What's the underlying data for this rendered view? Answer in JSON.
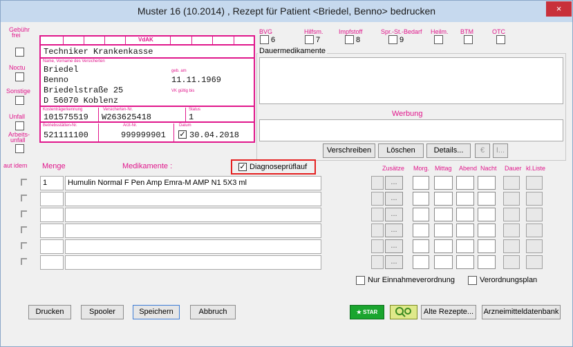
{
  "window": {
    "title": "Muster 16 (10.2014) , Rezept für Patient <Briedel, Benno> bedrucken",
    "close": "×"
  },
  "side_labels": {
    "gebuehr": "Gebühr",
    "frei": "frei",
    "noctu": "Noctu",
    "sonstige": "Sonstige",
    "unfall": "Unfall",
    "arbeits": "Arbeits-",
    "unfall2": "unfall"
  },
  "form": {
    "vdak": "VdAK",
    "kasse": "Techniker Krankenkasse",
    "name_label": "Name, Vorname des Versicherten",
    "lastname": "Briedel",
    "firstname": "Benno",
    "geb_label": "geb. am",
    "birthdate": "11.11.1969",
    "street": "Briedelstraße 25",
    "vk_label": "VK gültig bis",
    "city": "D 56070 Koblenz",
    "kt_label": "Kostenträgerkennung",
    "kt": "101575519",
    "vn_label": "Versicherten-Nr.",
    "vn": "W263625418",
    "status_label": "Status",
    "status": "1",
    "bs_label": "Betriebsstätten-Nr.",
    "bs": "521111100",
    "arzt_label": "Arzt-Nr.",
    "arzt": "999999901",
    "datum_label": "Datum",
    "datum": "30.04.2018"
  },
  "top_checks": [
    {
      "label": "BVG",
      "num": "6"
    },
    {
      "label": "Hilfsm.",
      "num": "7"
    },
    {
      "label": "Impfstoff",
      "num": "8"
    },
    {
      "label": "Spr.-St.-Bedarf",
      "num": "9"
    },
    {
      "label": "Heilm.",
      "num": ""
    },
    {
      "label": "BTM",
      "num": ""
    },
    {
      "label": "OTC",
      "num": ""
    }
  ],
  "dauer_label": "Dauermedikamente",
  "werbung_label": "Werbung",
  "buttons": {
    "verschreiben": "Verschreiben",
    "loeschen": "Löschen",
    "details": "Details...",
    "euro": "€",
    "i": "I...",
    "drucken": "Drucken",
    "spooler": "Spooler",
    "speichern": "Speichern",
    "abbruch": "Abbruch",
    "alte": "Alte Rezepte...",
    "arznei": "Arzneimitteldatenbank",
    "star": "STAR"
  },
  "med": {
    "aut_idem": "aut idem",
    "menge_label": "Menge",
    "medikamente_label": "Medikamente :",
    "diagnose": "Diagnoseprüflauf",
    "rows": [
      {
        "menge": "1",
        "med": "Humulin Normal F Pen Amp Emra-M AMP N1 5X3 ml"
      },
      {
        "menge": "",
        "med": ""
      },
      {
        "menge": "",
        "med": ""
      },
      {
        "menge": "",
        "med": ""
      },
      {
        "menge": "",
        "med": ""
      },
      {
        "menge": "",
        "med": ""
      }
    ],
    "ellipsis": "...",
    "cols": [
      "Zusätze",
      "Morg.",
      "Mittag",
      "Abend",
      "Nacht",
      "Dauer",
      "kl.Liste"
    ]
  },
  "bottom_checks": {
    "einnahme": "Nur Einnahmeverordnung",
    "plan": "Verordnungsplan"
  }
}
